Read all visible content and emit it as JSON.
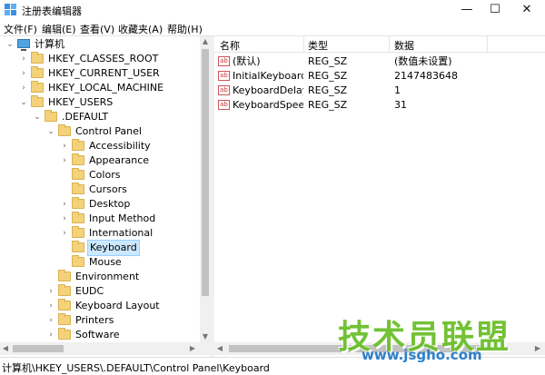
{
  "window": {
    "title": "注册表编辑器",
    "minimize": "—",
    "maximize": "☐",
    "close": "✕"
  },
  "menu": [
    "文件(F)",
    "编辑(E)",
    "查看(V)",
    "收藏夹(A)",
    "帮助(H)"
  ],
  "tree": [
    {
      "label": "计算机",
      "level": 0,
      "expander": "⌄",
      "icon": "computer-icon"
    },
    {
      "label": "HKEY_CLASSES_ROOT",
      "level": 1,
      "expander": "›"
    },
    {
      "label": "HKEY_CURRENT_USER",
      "level": 1,
      "expander": "›"
    },
    {
      "label": "HKEY_LOCAL_MACHINE",
      "level": 1,
      "expander": "›"
    },
    {
      "label": "HKEY_USERS",
      "level": 1,
      "expander": "⌄"
    },
    {
      "label": ".DEFAULT",
      "level": 2,
      "expander": "⌄"
    },
    {
      "label": "Control Panel",
      "level": 3,
      "expander": "⌄"
    },
    {
      "label": "Accessibility",
      "level": 4,
      "expander": "›"
    },
    {
      "label": "Appearance",
      "level": 4,
      "expander": "›"
    },
    {
      "label": "Colors",
      "level": 4,
      "expander": ""
    },
    {
      "label": "Cursors",
      "level": 4,
      "expander": ""
    },
    {
      "label": "Desktop",
      "level": 4,
      "expander": "›"
    },
    {
      "label": "Input Method",
      "level": 4,
      "expander": "›"
    },
    {
      "label": "International",
      "level": 4,
      "expander": "›"
    },
    {
      "label": "Keyboard",
      "level": 4,
      "expander": "",
      "selected": true
    },
    {
      "label": "Mouse",
      "level": 4,
      "expander": ""
    },
    {
      "label": "Environment",
      "level": 3,
      "expander": ""
    },
    {
      "label": "EUDC",
      "level": 3,
      "expander": "›"
    },
    {
      "label": "Keyboard Layout",
      "level": 3,
      "expander": "›"
    },
    {
      "label": "Printers",
      "level": 3,
      "expander": "›"
    },
    {
      "label": "Software",
      "level": 3,
      "expander": "›"
    }
  ],
  "list": {
    "headers": [
      "名称",
      "类型",
      "数据"
    ],
    "rows": [
      {
        "name": "(默认)",
        "type": "REG_SZ",
        "data": "(数值未设置)"
      },
      {
        "name": "InitialKeyboardIndicators",
        "type": "REG_SZ",
        "data": "2147483648"
      },
      {
        "name": "KeyboardDelay",
        "type": "REG_SZ",
        "data": "1"
      },
      {
        "name": "KeyboardSpeed",
        "type": "REG_SZ",
        "data": "31"
      }
    ]
  },
  "status": "计算机\\HKEY_USERS\\.DEFAULT\\Control Panel\\Keyboard",
  "watermark": {
    "main": "技术员联盟",
    "sub": "www.jsgho.com"
  },
  "colors": {
    "selected_bg": "#cce8ff",
    "folder": "#f3d27a",
    "watermark_green": "#6bbf2a"
  }
}
